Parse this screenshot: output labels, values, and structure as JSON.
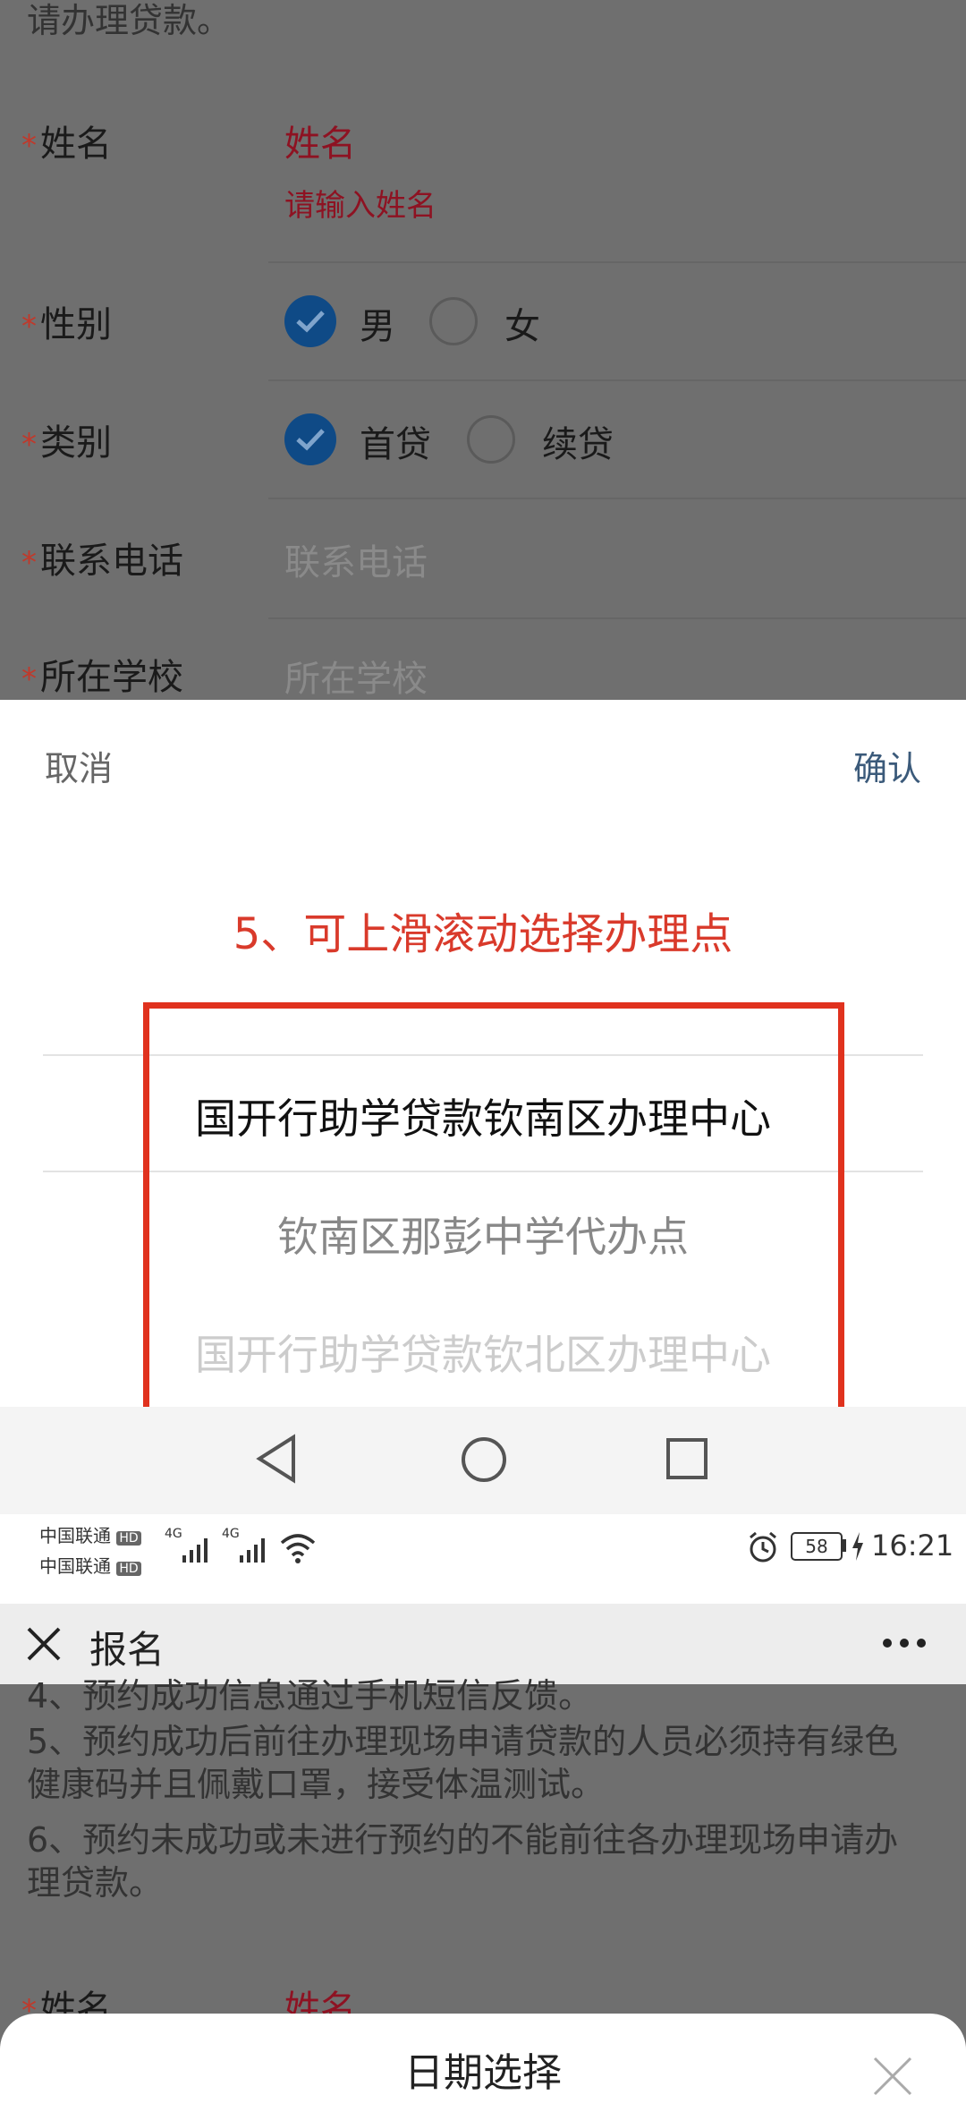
{
  "top_form": {
    "text_fragment": "请办理贷款。",
    "name_label": "姓名",
    "name_value": "姓名",
    "name_error": "请输入姓名",
    "gender_label": "性别",
    "gender_options": [
      "男",
      "女"
    ],
    "category_label": "类别",
    "category_options": [
      "首贷",
      "续贷"
    ],
    "phone_label": "联系电话",
    "phone_placeholder": "联系电话",
    "school_label": "所在学校",
    "school_placeholder": "所在学校",
    "required_mark": "*"
  },
  "picker": {
    "cancel": "取消",
    "confirm": "确认",
    "annotation": "5、可上滑滚动选择办理点",
    "items": [
      "国开行助学贷款钦南区办理中心",
      "钦南区那彭中学代办点",
      "国开行助学贷款钦北区办理中心"
    ],
    "annotation_color": "#d93a2b"
  },
  "statusbar": {
    "carrier1": "中国联通",
    "carrier2": "中国联通",
    "hd": "HD",
    "net": "4G",
    "battery": "58",
    "time": "16:21"
  },
  "header": {
    "title": "报名",
    "more": "..."
  },
  "lower_content": {
    "line4": "4、预约成功信息通过手机短信反馈。",
    "line5": "5、预约成功后前往办理现场申请贷款的人员必须持有绿色健康码并且佩戴口罩，接受体温测试。",
    "line6": "6、预约未成功或未进行预约的不能前往各办理现场申请办理贷款。",
    "name_label": "姓名",
    "name_value": "姓名"
  },
  "date_sheet": {
    "title": "日期选择"
  }
}
